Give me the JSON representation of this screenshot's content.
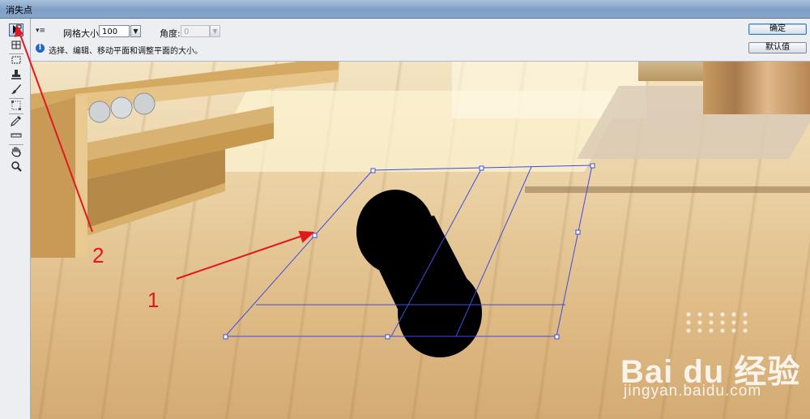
{
  "window": {
    "title": "消失点"
  },
  "options": {
    "grid_size_label": "网格大小:",
    "grid_size_value": "100",
    "angle_label": "角度:",
    "angle_value": "0",
    "ok_label": "确定",
    "default_label": "默认值",
    "info_text": "选择、编辑、移动平面和调整平面的大小。"
  },
  "tools": [
    {
      "name": "edit-plane-tool",
      "icon": "arrow-icon"
    },
    {
      "name": "create-plane-tool",
      "icon": "plane-grid-icon"
    },
    {
      "name": "marquee-tool",
      "icon": "marquee-icon"
    },
    {
      "name": "stamp-tool",
      "icon": "stamp-icon"
    },
    {
      "name": "brush-tool",
      "icon": "brush-icon"
    },
    {
      "name": "transform-tool",
      "icon": "transform-icon"
    },
    {
      "name": "eyedropper-tool",
      "icon": "eyedropper-icon"
    },
    {
      "name": "measure-tool",
      "icon": "ruler-icon"
    },
    {
      "name": "hand-tool",
      "icon": "hand-icon"
    },
    {
      "name": "zoom-tool",
      "icon": "zoom-icon"
    }
  ],
  "annotations": {
    "label_1": "1",
    "label_2": "2"
  },
  "colors": {
    "annotation": "#e1191f",
    "grid": "#3b4ee0",
    "canvas_wood": "#e2c28e"
  },
  "watermark": {
    "brand": "Bai du 经验",
    "url": "jingyan.baidu.com"
  }
}
